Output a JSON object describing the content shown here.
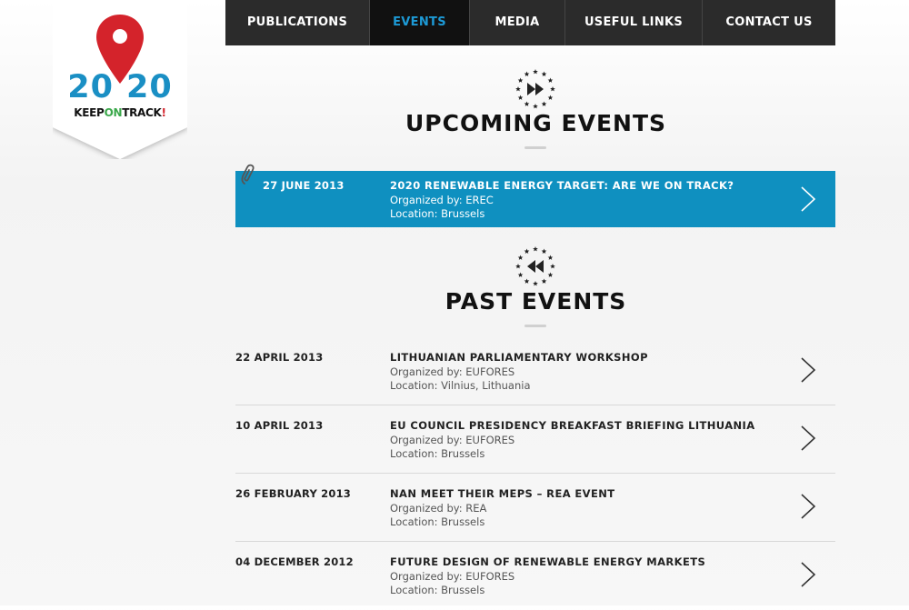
{
  "logo": {
    "number_left": "20",
    "number_right": "20",
    "tag_keep": "KEEP",
    "tag_on": "ON",
    "tag_track": "TRACK",
    "tag_bang": "!",
    "colors": {
      "pin": "#d4232b",
      "number": "#1a8fc4",
      "on": "#3aa84a"
    }
  },
  "nav": {
    "items": [
      {
        "label": "PUBLICATIONS",
        "active": false
      },
      {
        "label": "EVENTS",
        "active": true
      },
      {
        "label": "MEDIA",
        "active": false
      },
      {
        "label": "USEFUL LINKS",
        "active": false
      },
      {
        "label": "CONTACT US",
        "active": false
      }
    ]
  },
  "upcoming": {
    "heading": "UPCOMING EVENTS",
    "icon": "fast-forward-stars-icon",
    "event": {
      "date": "27 JUNE 2013",
      "title": "2020 RENEWABLE ENERGY TARGET: ARE WE ON TRACK?",
      "organized": "Organized by: EREC",
      "location": "Location: Brussels"
    }
  },
  "past": {
    "heading": "PAST EVENTS",
    "icon": "rewind-stars-icon",
    "events": [
      {
        "date": "22 APRIL 2013",
        "title": "LITHUANIAN PARLIAMENTARY WORKSHOP",
        "organized": "Organized by: EUFORES",
        "location": "Location: Vilnius, Lithuania"
      },
      {
        "date": "10 APRIL 2013",
        "title": "EU COUNCIL PRESIDENCY BREAKFAST BRIEFING LITHUANIA",
        "organized": "Organized by: EUFORES",
        "location": "Location: Brussels"
      },
      {
        "date": "26 FEBRUARY 2013",
        "title": "NAN MEET THEIR MEPS – REA EVENT",
        "organized": "Organized by: REA",
        "location": "Location: Brussels"
      },
      {
        "date": "04 DECEMBER 2012",
        "title": "FUTURE DESIGN OF RENEWABLE ENERGY MARKETS",
        "organized": "Organized by: EUFORES",
        "location": "Location: Brussels"
      }
    ]
  },
  "colors": {
    "accent": "#0f90c0",
    "nav_bg": "#2b2b2b",
    "nav_active_text": "#1d9ad6"
  }
}
